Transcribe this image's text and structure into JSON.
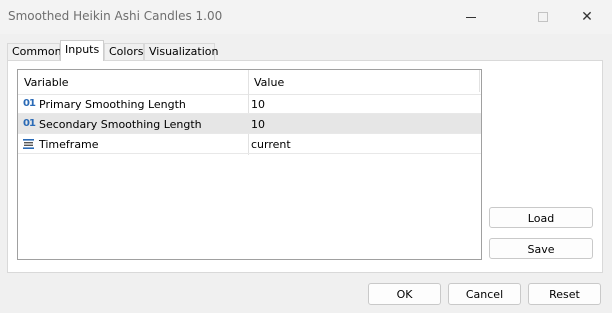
{
  "window": {
    "title": "Smoothed Heikin Ashi Candles 1.00",
    "close_glyph": "✕"
  },
  "tabs": [
    {
      "label": "Common"
    },
    {
      "label": "Inputs",
      "active": true
    },
    {
      "label": "Colors"
    },
    {
      "label": "Visualization"
    }
  ],
  "grid": {
    "headers": {
      "variable": "Variable",
      "value": "Value"
    },
    "rows": [
      {
        "icon": "integer-icon",
        "icon_text": "01",
        "name": "Primary Smoothing Length",
        "value": "10",
        "selected": false
      },
      {
        "icon": "integer-icon",
        "icon_text": "01",
        "name": "Secondary Smoothing Length",
        "value": "10",
        "selected": true
      },
      {
        "icon": "enum-list-icon",
        "name": "Timeframe",
        "value": "current",
        "selected": false
      }
    ]
  },
  "buttons": {
    "load": "Load",
    "save": "Save",
    "ok": "OK",
    "cancel": "Cancel",
    "reset": "Reset"
  },
  "colors": {
    "icon_blue": "#2a6ab6",
    "selected_row": "#e6e6e6"
  }
}
